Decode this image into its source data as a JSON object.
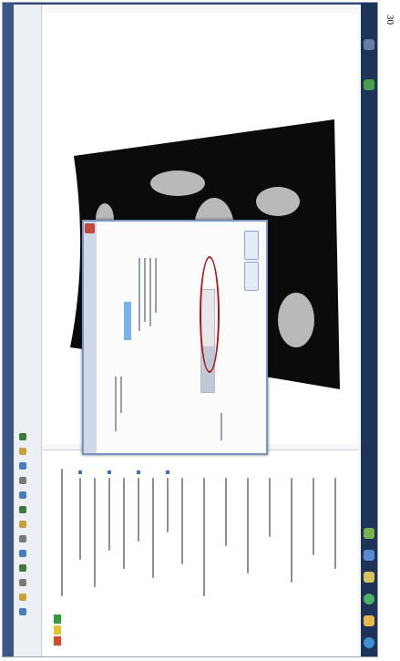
{
  "page_number": "30",
  "colors": {
    "desktop": "#2f4876",
    "taskbar": "#1d3357",
    "annotation": "#b0151c",
    "dialog_border": "#7b94bd",
    "imagery": "#0b0b0b"
  },
  "taskbar_icons": [
    "start-orb-icon",
    "explorer-icon",
    "chrome-icon",
    "folder-icon",
    "app-icon",
    "app-icon",
    "network-icon",
    "volume-icon"
  ],
  "dialog": {
    "progress": 0.45
  }
}
